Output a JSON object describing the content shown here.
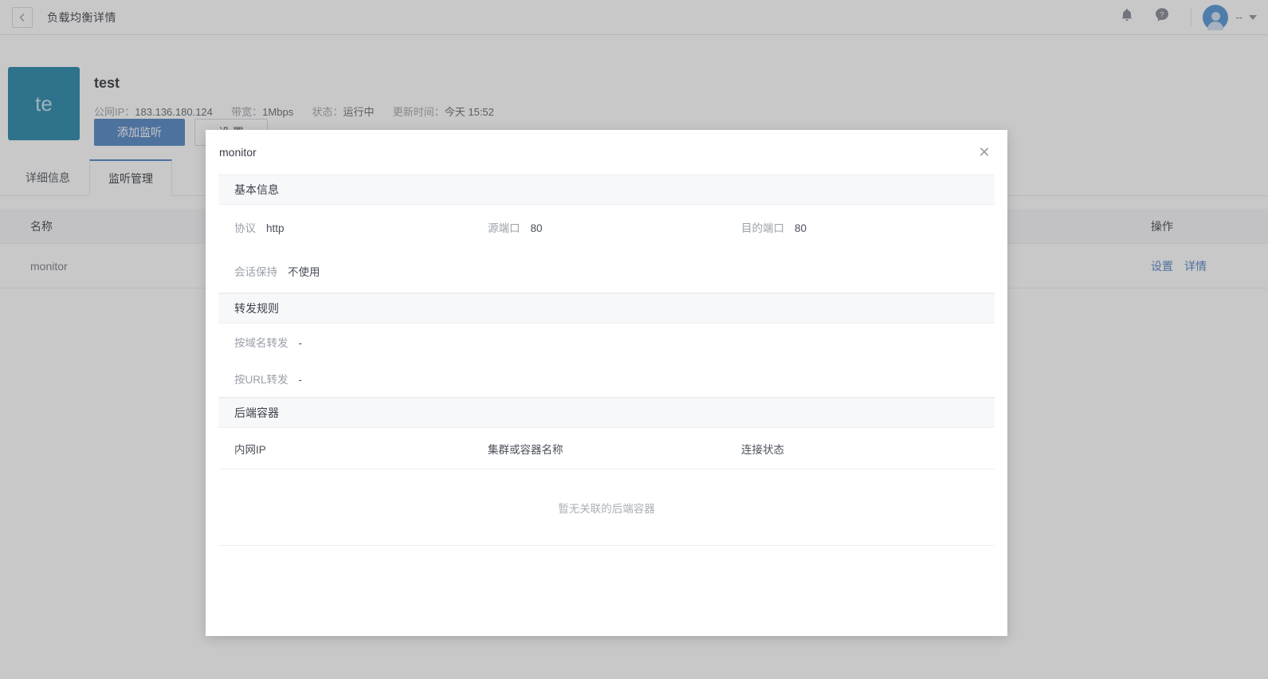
{
  "topbar": {
    "back_icon": "chevron-left-icon",
    "title": "负载均衡详情",
    "bell_icon": "bell-icon",
    "help_icon": "help-circle-icon",
    "avatar_icon": "user-avatar-icon",
    "user_name": "--",
    "caret_icon": "chevron-down-icon"
  },
  "resource": {
    "thumb_text": "te",
    "thumb_color": "#1b7fa5",
    "name": "test",
    "meta": {
      "ip_label": "公网IP：",
      "ip_value": "183.136.180.124",
      "bandwidth_label": "带宽：",
      "bandwidth_value": "1Mbps",
      "status_label": "状态：",
      "status_value": "运行中",
      "updated_label": "更新时间：",
      "updated_value": "今天 15:52"
    },
    "primary_button": "添加监听",
    "secondary_button": "设 置"
  },
  "tabs": [
    {
      "label": "详细信息",
      "active": false
    },
    {
      "label": "监听管理",
      "active": true
    }
  ],
  "table": {
    "columns": {
      "name": "名称",
      "operation": "操作"
    },
    "rows": [
      {
        "name": "monitor",
        "actions": [
          "设置",
          "详情"
        ]
      }
    ]
  },
  "modal": {
    "title": "monitor",
    "close_icon": "close-icon",
    "sections": {
      "basic": {
        "heading": "基本信息",
        "fields": [
          {
            "label": "协议",
            "value": "http"
          },
          {
            "label": "源端口",
            "value": "80"
          },
          {
            "label": "目的端口",
            "value": "80"
          },
          {
            "label": "会话保持",
            "value": "不使用"
          }
        ]
      },
      "forward": {
        "heading": "转发规则",
        "fields": [
          {
            "label": "按域名转发",
            "value": "-"
          },
          {
            "label": "按URL转发",
            "value": "-"
          }
        ]
      },
      "backend": {
        "heading": "后端容器",
        "columns": [
          "内网IP",
          "集群或容器名称",
          "连接状态"
        ],
        "empty_text": "暂无关联的后端容器"
      }
    }
  },
  "colors": {
    "primary": "#4a7fc1",
    "link": "#4a7fc1",
    "thumb": "#1b7fa5",
    "section_bg": "#f7f8fa"
  }
}
